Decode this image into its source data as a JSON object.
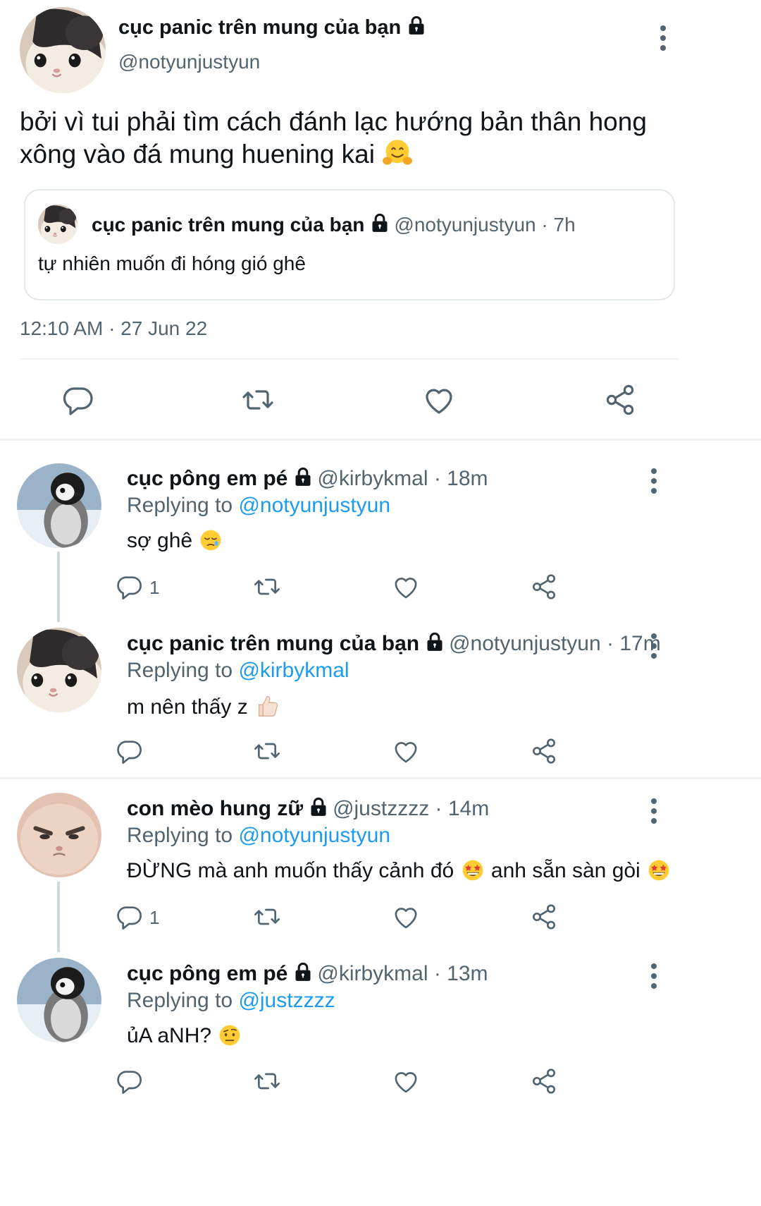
{
  "main_tweet": {
    "name": "cục panic trên mung của bạn",
    "handle": "@notyunjustyun",
    "text": "bởi vì tui phải tìm cách đánh lạc hướng bản thân hong xông vào đá mung huening kai",
    "emoji": "hugging-face",
    "timestamp": "12:10 AM · 27 Jun 22",
    "quoted": {
      "name": "cục panic trên mung của bạn",
      "handle": "@notyunjustyun",
      "time": "· 7h",
      "text": "tự nhiên muốn đi hóng gió ghê"
    }
  },
  "replies": [
    {
      "name": "cục pông em pé",
      "handle": "@kirbykmal",
      "time": "· 18m",
      "replying_prefix": "Replying to",
      "replying_to": "@notyunjustyun",
      "text": "sợ ghê",
      "reply_count": "1",
      "avatar": "penguin"
    },
    {
      "name": "cục panic trên mung của bạn",
      "handle": "@notyunjustyun",
      "time": "· 17m",
      "replying_prefix": "Replying to",
      "replying_to": "@kirbykmal",
      "text": "m nên thấy z",
      "reply_count": "",
      "avatar": "cat"
    },
    {
      "name": "con mèo hung zữ",
      "handle": "@justzzzz",
      "time": "· 14m",
      "replying_prefix": "Replying to",
      "replying_to": "@notyunjustyun",
      "text_a": "ĐỪNG mà anh muốn thấy cảnh đó",
      "text_b": "anh sẵn sàn gòi",
      "reply_count": "1",
      "avatar": "grumpy-cat"
    },
    {
      "name": "cục pông em pé",
      "handle": "@kirbykmal",
      "time": "· 13m",
      "replying_prefix": "Replying to",
      "replying_to": "@justzzzz",
      "text": "ủA aNH?",
      "reply_count": "",
      "avatar": "penguin"
    }
  ],
  "icons": [
    "reply-icon",
    "retweet-icon",
    "like-icon",
    "share-icon",
    "lock-icon",
    "more-icon"
  ],
  "colors": {
    "link": "#1d9bf0",
    "muted": "#536471",
    "divider": "#eff3f4"
  }
}
